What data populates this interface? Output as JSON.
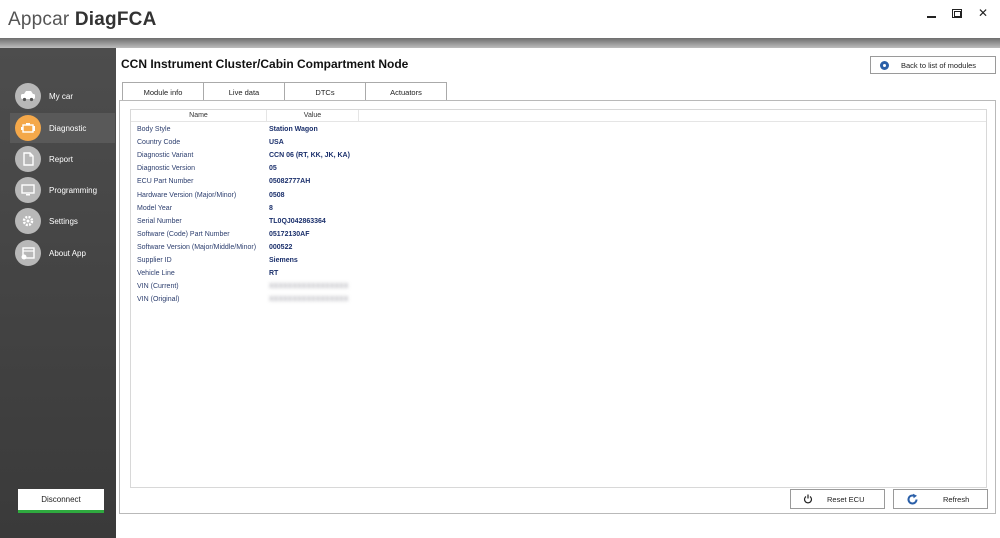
{
  "app": {
    "title_light": "Appcar ",
    "title_bold": "DiagFCA"
  },
  "sidebar": {
    "items": [
      {
        "label": "My car",
        "icon": "car-icon"
      },
      {
        "label": "Diagnostic",
        "icon": "engine-icon",
        "active": true
      },
      {
        "label": "Report",
        "icon": "document-icon"
      },
      {
        "label": "Programming",
        "icon": "monitor-icon"
      },
      {
        "label": "Settings",
        "icon": "gear-icon"
      },
      {
        "label": "About App",
        "icon": "info-window-icon"
      }
    ],
    "disconnect_label": "Disconnect"
  },
  "main": {
    "title": "CCN Instrument Cluster/Cabin Compartment Node",
    "back_label": "Back to list of modules",
    "tabs": [
      {
        "label": "Module info",
        "active": true
      },
      {
        "label": "Live data"
      },
      {
        "label": "DTCs"
      },
      {
        "label": "Actuators"
      }
    ],
    "table": {
      "headers": [
        "Name",
        "Value"
      ],
      "rows": [
        {
          "name": "Body Style",
          "value": "Station Wagon"
        },
        {
          "name": "Country Code",
          "value": "USA"
        },
        {
          "name": "Diagnostic Variant",
          "value": "CCN 06 (RT, KK, JK, KA)"
        },
        {
          "name": "Diagnostic Version",
          "value": "05"
        },
        {
          "name": "ECU Part Number",
          "value": "05082777AH"
        },
        {
          "name": "Hardware Version (Major/Minor)",
          "value": "0508"
        },
        {
          "name": "Model Year",
          "value": "8"
        },
        {
          "name": "Serial Number",
          "value": "TL0QJ042863364"
        },
        {
          "name": "Software (Code) Part Number",
          "value": "05172130AF"
        },
        {
          "name": "Software Version (Major/Middle/Minor)",
          "value": "000522"
        },
        {
          "name": "Supplier ID",
          "value": "Siemens"
        },
        {
          "name": "Vehicle Line",
          "value": "RT"
        },
        {
          "name": "VIN (Current)",
          "value": ""
        },
        {
          "name": "VIN (Original)",
          "value": ""
        }
      ]
    },
    "reset_label": "Reset ECU",
    "refresh_label": "Refresh"
  },
  "colors": {
    "accent_orange": "#f4a84a",
    "disconnect_green": "#2faa3f",
    "value_blue": "#1a2f6b",
    "back_icon_blue": "#2a5fa8"
  }
}
